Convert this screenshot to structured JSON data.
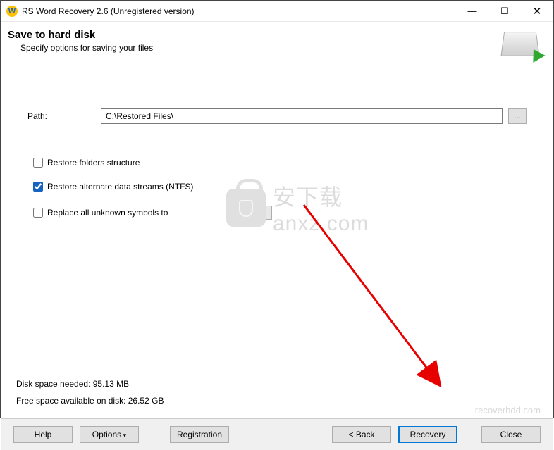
{
  "titlebar": {
    "title": "RS Word Recovery 2.6 (Unregistered version)"
  },
  "header": {
    "title": "Save to hard disk",
    "subtitle": "Specify options for saving your files"
  },
  "path": {
    "label": "Path:",
    "value": "C:\\Restored Files\\",
    "browse": "..."
  },
  "options": {
    "restore_folders": {
      "label": "Restore folders structure",
      "checked": false
    },
    "restore_ads": {
      "label": "Restore alternate data streams (NTFS)",
      "checked": true
    },
    "replace_unknown": {
      "label": "Replace all unknown symbols to",
      "checked": false,
      "value": ""
    }
  },
  "info": {
    "disk_needed": "Disk space needed: 95.13 MB",
    "free_space": "Free space available on disk: 26.52 GB"
  },
  "watermark": {
    "cn": "安下载",
    "url_text": "anxz.com",
    "footer_url": "recoverhdd.com"
  },
  "footer": {
    "help": "Help",
    "options": "Options",
    "registration": "Registration",
    "back": "< Back",
    "recovery": "Recovery",
    "close": "Close"
  }
}
